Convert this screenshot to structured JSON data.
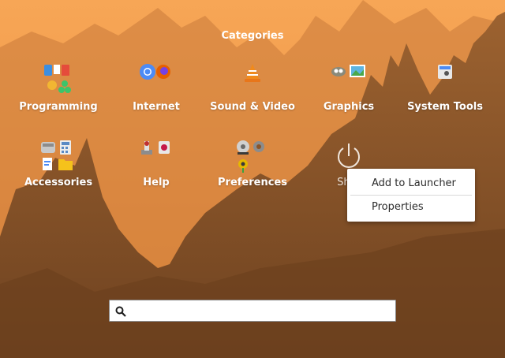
{
  "heading": "Categories",
  "categories": [
    {
      "label": "Programming"
    },
    {
      "label": "Internet"
    },
    {
      "label": "Sound & Video"
    },
    {
      "label": "Graphics"
    },
    {
      "label": "System Tools"
    },
    {
      "label": "Accessories"
    },
    {
      "label": "Help"
    },
    {
      "label": "Preferences"
    },
    {
      "label": "Shut"
    }
  ],
  "context_menu": {
    "items": [
      {
        "label": "Add to Launcher"
      },
      {
        "label": "Properties"
      }
    ]
  },
  "search": {
    "value": "",
    "placeholder": ""
  },
  "colors": {
    "sky_top": "#f6a04e",
    "sky_bottom": "#e88a3a",
    "mountain": "#8a5427",
    "text": "#ffffff"
  }
}
